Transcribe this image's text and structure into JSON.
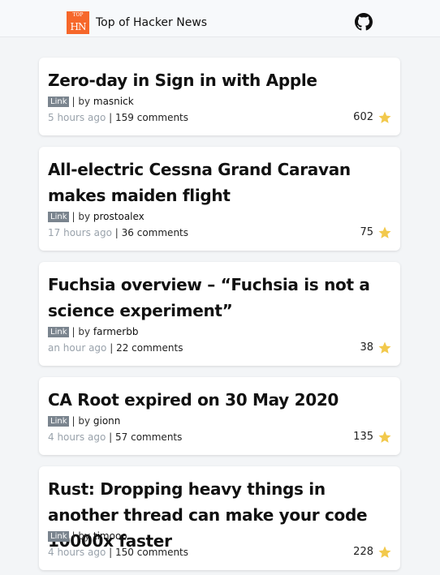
{
  "header": {
    "logo_top": "TOP",
    "logo_text": "HN",
    "title": "Top of Hacker News",
    "github_icon": "github-icon",
    "brand_color": "#f6672a"
  },
  "stories": [
    {
      "title": "Zero-day in Sign in with Apple",
      "badge": "Link",
      "by_text": "| by",
      "author": "masnick",
      "time": "5 hours ago",
      "sep": "|",
      "comments": "159 comments",
      "score": "602"
    },
    {
      "title": "All-electric Cessna Grand Caravan makes maiden flight",
      "badge": "Link",
      "by_text": "| by",
      "author": "prostoalex",
      "time": "17 hours ago",
      "sep": "|",
      "comments": "36 comments",
      "score": "75"
    },
    {
      "title": "Fuchsia overview – “Fuchsia is not a science experiment”",
      "badge": "Link",
      "by_text": "| by",
      "author": "farmerbb",
      "time": "an hour ago",
      "sep": "|",
      "comments": "22 comments",
      "score": "38"
    },
    {
      "title": "CA Root expired on 30 May 2020",
      "badge": "Link",
      "by_text": "| by",
      "author": "gionn",
      "time": "4 hours ago",
      "sep": "|",
      "comments": "57 comments",
      "score": "135"
    },
    {
      "title": "Rust: Dropping heavy things in another thread can make your code 10000x faster",
      "badge": "Link",
      "by_text": "| by",
      "author": "timooo",
      "time": "4 hours ago",
      "sep": "|",
      "comments": "150 comments",
      "score": "228"
    }
  ],
  "star_color": "#f2c94c"
}
